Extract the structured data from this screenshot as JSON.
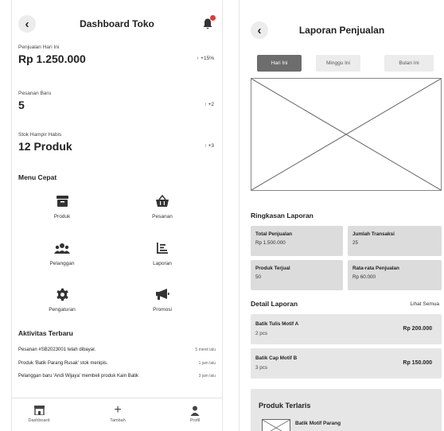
{
  "dashboard": {
    "title": "Dashboard Toko",
    "stats": [
      {
        "label": "Penjualan Hari Ini",
        "value": "Rp 1.250.000",
        "change": "↑ +15%"
      },
      {
        "label": "Pesanan Baru",
        "value": "5",
        "change": "↑ +2"
      },
      {
        "label": "Stok Hampir Habis",
        "value": "12 Produk",
        "change": "↑ +3"
      }
    ],
    "quick_menu_title": "Menu Cepat",
    "quick_menu": [
      {
        "label": "Produk",
        "icon": "box-icon"
      },
      {
        "label": "Pesanan",
        "icon": "basket-icon"
      },
      {
        "label": "Pelanggan",
        "icon": "users-icon"
      },
      {
        "label": "Laporan",
        "icon": "chart-icon"
      },
      {
        "label": "Pengaturan",
        "icon": "gear-icon"
      },
      {
        "label": "Promosi",
        "icon": "megaphone-icon"
      }
    ],
    "activity_title": "Aktivitas Terbaru",
    "activities": [
      {
        "text": "Pesanan #SB2023001 telah dibayar.",
        "time": "5 menit lalu"
      },
      {
        "text": "Produk 'Batik Parang Rusak' stok menipis.",
        "time": "1 jam lalu"
      },
      {
        "text": "Pelanggan baru 'Andi Wijaya' membeli produk Kain Batik",
        "time": "3 jam lalu"
      }
    ],
    "nav": [
      {
        "label": "Dashboard",
        "icon": "store-icon"
      },
      {
        "label": "Tambah",
        "icon": "plus-icon"
      },
      {
        "label": "Profil",
        "icon": "user-icon"
      }
    ]
  },
  "report": {
    "title": "Laporan Penjualan",
    "tabs": [
      "Hari Ini",
      "Minggu Ini",
      "Bulan Ini"
    ],
    "active_tab": 0,
    "summary_title": "Ringkasan Laporan",
    "summary": [
      {
        "title": "Total Penjualan",
        "value": "Rp 1.500.000"
      },
      {
        "title": "Jumlah Transaksi",
        "value": "25"
      },
      {
        "title": "Produk Terjual",
        "value": "50"
      },
      {
        "title": "Rata-rata Penjualan",
        "value": "Rp 60.000"
      }
    ],
    "detail_title": "Detail Laporan",
    "see_all": "Lihat Semua",
    "details": [
      {
        "name": "Batik Tulis Motif A",
        "qty": "2 pcs",
        "price": "Rp 200.000"
      },
      {
        "name": "Batik Cap Motif B",
        "qty": "3 pcs",
        "price": "Rp 150.000"
      }
    ],
    "best_title": "Produk Terlaris",
    "best_item": "Batik Motif Parang"
  },
  "colors": {
    "accent_active_tab": "#6d6d6d",
    "notification_dot": "#e53935",
    "card_bg": "#dcdcdc"
  }
}
